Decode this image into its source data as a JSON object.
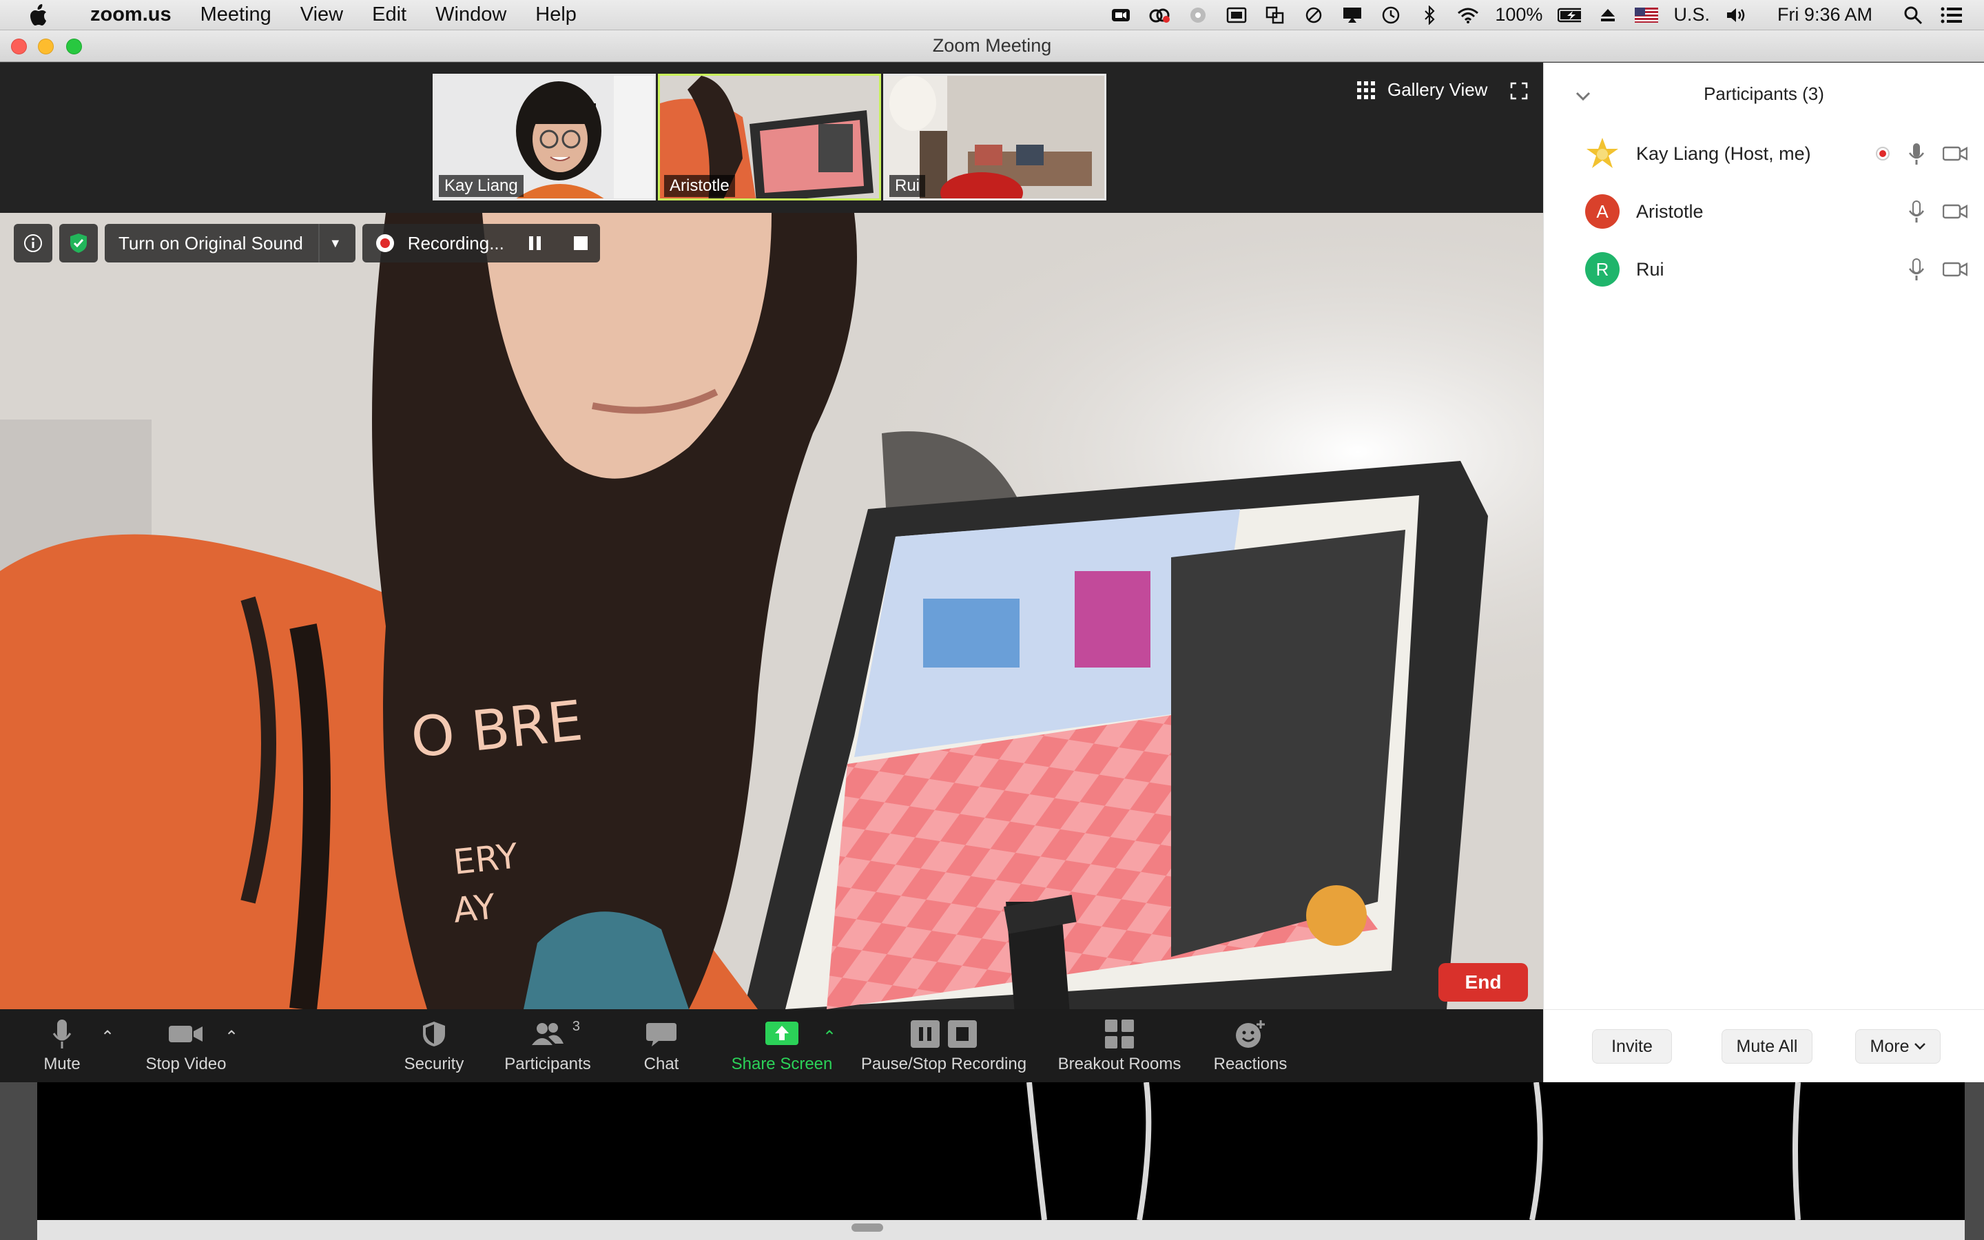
{
  "menubar": {
    "app_name": "zoom.us",
    "items": [
      "Meeting",
      "View",
      "Edit",
      "Window",
      "Help"
    ],
    "battery": "100%",
    "input_source": "U.S.",
    "clock": "Fri 9:36 AM"
  },
  "window": {
    "title": "Zoom Meeting"
  },
  "thumbnails": [
    {
      "name": "Kay Liang"
    },
    {
      "name": "Aristotle"
    },
    {
      "name": "Rui"
    }
  ],
  "view_controls": {
    "gallery_label": "Gallery View"
  },
  "overlay": {
    "original_sound_label": "Turn on Original Sound",
    "recording_label": "Recording..."
  },
  "toolbar": {
    "mute": "Mute",
    "stop_video": "Stop Video",
    "security": "Security",
    "participants": "Participants",
    "participants_count": "3",
    "chat": "Chat",
    "share_screen": "Share Screen",
    "pause_stop_recording": "Pause/Stop Recording",
    "breakout_rooms": "Breakout Rooms",
    "reactions": "Reactions",
    "end": "End"
  },
  "panel": {
    "title": "Participants (3)",
    "participants": [
      {
        "name": "Kay Liang (Host, me)",
        "avatar": "",
        "avatar_color": "#f2c230"
      },
      {
        "name": "Aristotle",
        "avatar": "A",
        "avatar_color": "#d9412b"
      },
      {
        "name": "Rui",
        "avatar": "R",
        "avatar_color": "#1fb56b"
      }
    ],
    "footer": {
      "invite": "Invite",
      "mute_all": "Mute All",
      "more": "More"
    }
  },
  "colors": {
    "recording_red": "#e02a2a",
    "share_green": "#2bd158",
    "end_red": "#d9312b",
    "security_green": "#22b55a"
  }
}
